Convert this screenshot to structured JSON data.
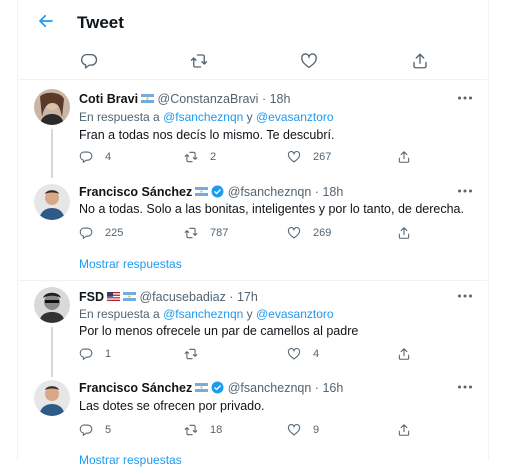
{
  "header": {
    "title": "Tweet"
  },
  "top_actions": [
    "reply-icon",
    "retweet-icon",
    "like-icon",
    "share-icon"
  ],
  "tweets": [
    {
      "name": "Coti Bravi",
      "flags": [
        "argentina-flag"
      ],
      "handle": "@ConstanzaBravi",
      "dot": "·",
      "time": "18h",
      "reply_prefix": "En respuesta a",
      "mention1": "@fsancheznqn",
      "reply_and": "y",
      "mention2": "@evasanztoro",
      "text": "Fran a todas nos decís lo mismo. Te descubrí.",
      "replies": "4",
      "retweets": "2",
      "likes": "267"
    },
    {
      "name": "Francisco Sánchez",
      "verified": true,
      "flags": [
        "argentina-flag"
      ],
      "handle": "@fsancheznqn",
      "dot": "·",
      "time": "18h",
      "text": "No a todas. Solo a las bonitas, inteligentes y por lo tanto, de derecha.",
      "replies": "225",
      "retweets": "787",
      "likes": "269",
      "show_replies": "Mostrar respuestas"
    },
    {
      "name": "FSD",
      "flags": [
        "usa-flag",
        "argentina-flag"
      ],
      "handle": "@facusebadiaz",
      "dot": "·",
      "time": "17h",
      "reply_prefix": "En respuesta a",
      "mention1": "@fsancheznqn",
      "reply_and": "y",
      "mention2": "@evasanztoro",
      "text": "Por lo menos ofrecele un par de camellos al padre",
      "replies": "1",
      "retweets": "",
      "likes": "4"
    },
    {
      "name": "Francisco Sánchez",
      "verified": true,
      "flags": [
        "argentina-flag"
      ],
      "handle": "@fsancheznqn",
      "dot": "·",
      "time": "16h",
      "text": "Las dotes se ofrecen por privado.",
      "replies": "5",
      "retweets": "18",
      "likes": "9",
      "show_replies": "Mostrar respuestas"
    }
  ],
  "colors": {
    "accent": "#1d9bf0",
    "text": "#0f1419",
    "muted": "#536471",
    "border": "#eff3f4"
  }
}
